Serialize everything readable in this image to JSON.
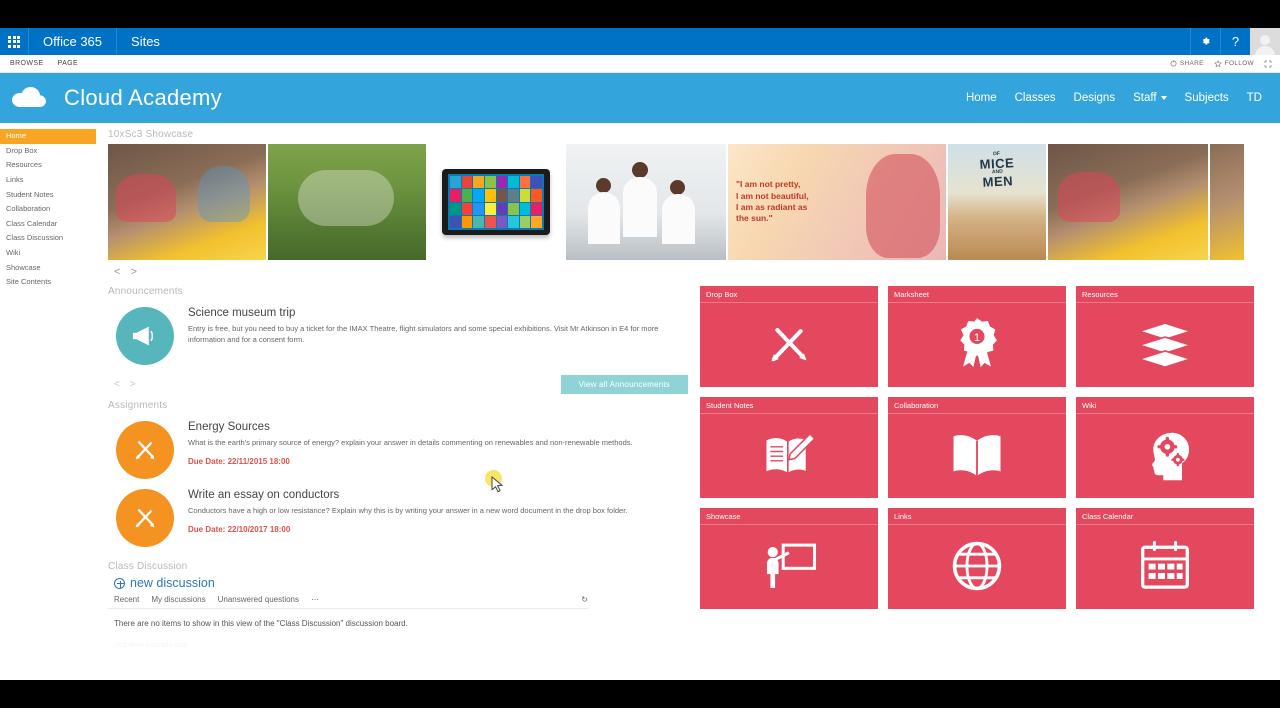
{
  "suite_bar": {
    "waffle_icon": "app-launcher-icon",
    "brand": "Office 365",
    "sites": "Sites",
    "settings_icon": "gear-icon",
    "help_icon": "help-icon",
    "avatar_icon": "user-avatar"
  },
  "ribbon": {
    "tabs": [
      "BROWSE",
      "PAGE"
    ],
    "share": "SHARE",
    "follow": "FOLLOW",
    "focus_icon": "focus-on-content-icon"
  },
  "site_header": {
    "logo_icon": "cloud-logo",
    "title": "Cloud Academy",
    "nav": [
      {
        "label": "Home",
        "has_caret": false
      },
      {
        "label": "Classes",
        "has_caret": false
      },
      {
        "label": "Designs",
        "has_caret": false
      },
      {
        "label": "Staff",
        "has_caret": true
      },
      {
        "label": "Subjects",
        "has_caret": false
      },
      {
        "label": "TD",
        "has_caret": false
      }
    ]
  },
  "quicklaunch": {
    "items": [
      {
        "label": "Home",
        "active": true
      },
      {
        "label": "Drop Box",
        "active": false
      },
      {
        "label": "Resources",
        "active": false
      },
      {
        "label": "Links",
        "active": false
      },
      {
        "label": "Student Notes",
        "active": false
      },
      {
        "label": "Collaboration",
        "active": false
      },
      {
        "label": "Class Calendar",
        "active": false
      },
      {
        "label": "Class Discussion",
        "active": false
      },
      {
        "label": "Wiki",
        "active": false
      },
      {
        "label": "Showcase",
        "active": false
      },
      {
        "label": "Site Contents",
        "active": false
      }
    ]
  },
  "showcase": {
    "label": "10xSc3 Showcase",
    "prev": "<",
    "next": ">",
    "slides": [
      {
        "name": "students-laptops-photo"
      },
      {
        "name": "students-grass-photo"
      },
      {
        "name": "windows-tablet-photo"
      },
      {
        "name": "students-classroom-photo"
      },
      {
        "name": "radiant-quote-poster",
        "quote": "\"I am not pretty,\n I am not beautiful,\n I am as radiant as\n the sun.\""
      },
      {
        "name": "of-mice-and-men-cover",
        "title_small": "OF",
        "title_line1": "MICE",
        "title_small2": "AND",
        "title_line2": "MEN"
      },
      {
        "name": "students-laptops-photo-2"
      },
      {
        "name": "slide-edge"
      }
    ]
  },
  "announcements": {
    "label": "Announcements",
    "icon": "megaphone-icon",
    "item": {
      "title": "Science museum trip",
      "body": "Entry is free, but you need to buy a ticket for the IMAX Theatre, flight simulators and some special exhibitions. Visit Mr Atkinson in E4 for more information and for a consent form."
    },
    "prev": "<",
    "next": ">",
    "view_all_label": "View all Announcements"
  },
  "assignments": {
    "label": "Assignments",
    "icon": "pencil-ruler-icon",
    "items": [
      {
        "title": "Energy Sources",
        "body": "What is the earth's primary source of energy? explain your answer in details commenting on renewables and non-renewable methods.",
        "due": "Due Date: 22/11/2015 18:00"
      },
      {
        "title": "Write an essay on conductors",
        "body": "Conductors have a high or low resistance? Explain why this is by writing your answer in a new word document in the drop box folder.",
        "due": "Due Date: 22/10/2017 18:00"
      }
    ]
  },
  "class_discussion": {
    "label": "Class Discussion",
    "new_discussion": "new discussion",
    "tabs": [
      "Recent",
      "My discussions",
      "Unanswered questions",
      "⋯"
    ],
    "refresh_icon": "refresh-icon",
    "empty_text": "There are no items to show in this view of the \"Class Discussion\" discussion board.",
    "footer": "Visit www.example.com"
  },
  "tiles": [
    {
      "label": "Drop Box",
      "icon": "pencil-ruler-icon"
    },
    {
      "label": "Marksheet",
      "icon": "award-ribbon-icon"
    },
    {
      "label": "Resources",
      "icon": "book-stack-icon"
    },
    {
      "label": "Student Notes",
      "icon": "notebook-pencil-icon"
    },
    {
      "label": "Collaboration",
      "icon": "open-book-icon"
    },
    {
      "label": "Wiki",
      "icon": "head-gears-icon"
    },
    {
      "label": "Showcase",
      "icon": "presenter-board-icon"
    },
    {
      "label": "Links",
      "icon": "globe-icon"
    },
    {
      "label": "Class Calendar",
      "icon": "calendar-icon"
    }
  ],
  "colors": {
    "suite_blue": "#0072c6",
    "site_blue": "#34a5dc",
    "tile_red": "#e4485f",
    "accent_orange": "#f6a623",
    "teal": "#57b6bb",
    "due_red": "#d9534f"
  }
}
